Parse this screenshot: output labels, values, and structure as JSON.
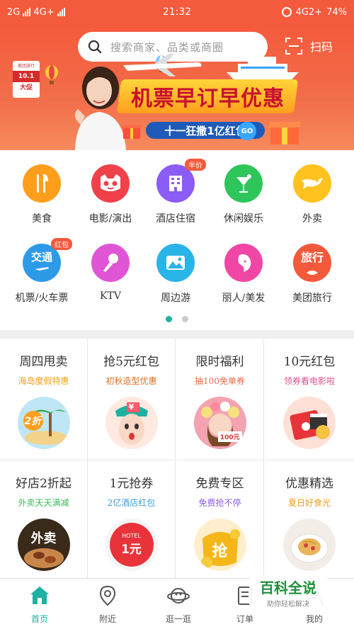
{
  "status_bar": {
    "carrier1": "2G",
    "carrier2": "4G+",
    "time": "21:32",
    "network": "4G2+",
    "battery": "74%"
  },
  "search": {
    "placeholder": "搜索商家、品类或商圈"
  },
  "scan": {
    "label": "扫码"
  },
  "banner": {
    "title": "机票早订早优惠",
    "subtitle": "十一狂撒1亿红包",
    "go": "GO",
    "badge_small": "美团旅行",
    "badge_big": "10.1",
    "badge_sub": "大促"
  },
  "categories": [
    {
      "label": "美食",
      "icon": "fork-knife-icon",
      "color": "#ff9e1b",
      "tag": ""
    },
    {
      "label": "电影/演出",
      "icon": "cat-face-icon",
      "color": "#f0414b",
      "tag": ""
    },
    {
      "label": "酒店住宿",
      "icon": "building-icon",
      "color": "#8b5cf6",
      "tag": "半价"
    },
    {
      "label": "休闲娱乐",
      "icon": "cocktail-icon",
      "color": "#2ec55a",
      "tag": ""
    },
    {
      "label": "外卖",
      "icon": "runner-icon",
      "color": "#ffc21f",
      "tag": ""
    },
    {
      "label": "机票/火车票",
      "icon": "plane-icon",
      "color": "#2d9ae8",
      "tag": "红包"
    },
    {
      "label": "KTV",
      "icon": "microphone-icon",
      "color": "#e055d6",
      "tag": ""
    },
    {
      "label": "周边游",
      "icon": "mountain-icon",
      "color": "#29b4e8",
      "tag": ""
    },
    {
      "label": "丽人/美发",
      "icon": "woman-face-icon",
      "color": "#f046a6",
      "tag": ""
    },
    {
      "label": "美团旅行",
      "icon": "travel-icon",
      "color": "#f25a3b",
      "tag": ""
    }
  ],
  "category_texts": {
    "transport": "交通",
    "travel": "旅行"
  },
  "pager": {
    "count": 2,
    "active": 0
  },
  "promos": [
    {
      "title": "周四甩卖",
      "sub": "海岛度假特惠",
      "sub_color": "#f0a020",
      "img": "island-image",
      "img_text": "2折"
    },
    {
      "title": "抢5元红包",
      "sub": "初秋造型优惠",
      "sub_color": "#e07020",
      "img": "girl-image",
      "img_text": "¥"
    },
    {
      "title": "限时福利",
      "sub": "抽100免单券",
      "sub_color": "#f06a4a",
      "img": "flower-woman-image",
      "img_text": "100元"
    },
    {
      "title": "10元红包",
      "sub": "领券看电影啦",
      "sub_color": "#e0508a",
      "img": "cinema-image",
      "img_text": ""
    },
    {
      "title": "好店2折起",
      "sub": "外卖天天满减",
      "sub_color": "#3cba5a",
      "img": "takeout-image",
      "img_text": "外卖"
    },
    {
      "title": "1元抢券",
      "sub": "2亿酒店红包",
      "sub_color": "#3a9fd8",
      "img": "hotel-coupon-image",
      "img_text": "1元"
    },
    {
      "title": "免费专区",
      "sub": "免费抢不停",
      "sub_color": "#8a5be0",
      "img": "gold-coin-image",
      "img_text": "抢"
    },
    {
      "title": "优惠精选",
      "sub": "夏日好食光",
      "sub_color": "#f0a020",
      "img": "pasta-image",
      "img_text": ""
    }
  ],
  "hotel_word": "HOTEL",
  "bottom_nav": [
    {
      "label": "首页",
      "icon": "home-icon",
      "active": true
    },
    {
      "label": "附近",
      "icon": "location-pin-icon",
      "active": false
    },
    {
      "label": "逛一逛",
      "icon": "planet-icon",
      "active": false
    },
    {
      "label": "订单",
      "icon": "order-icon",
      "active": false
    },
    {
      "label": "我的",
      "icon": "profile-icon",
      "active": false
    }
  ],
  "watermark": {
    "title": "百科全说",
    "sub": "助你轻松解决"
  },
  "colors": {
    "primary": "#f45a3c",
    "accent": "#1cb1a0"
  }
}
